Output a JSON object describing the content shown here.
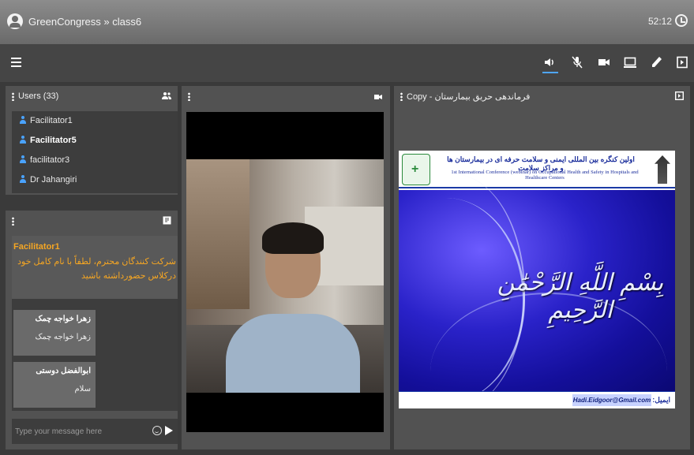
{
  "topbar": {
    "title": "GreenCongress » class6",
    "timer": "52:12"
  },
  "toolbar": {
    "speaker_icon": "speaker-icon",
    "mic_icon": "mic-off-icon",
    "camera_icon": "camera-icon",
    "screen_icon": "screen-share-icon",
    "pen_icon": "pen-icon",
    "exit_icon": "exit-icon"
  },
  "users_panel": {
    "title": "Users (33)",
    "users": [
      {
        "name": "Facilitator1",
        "bold": false
      },
      {
        "name": "Facilitator5",
        "bold": true
      },
      {
        "name": "facilitator3",
        "bold": false
      },
      {
        "name": "Dr Jahangiri",
        "bold": false
      }
    ]
  },
  "chat_panel": {
    "main_message": {
      "author": "Facilitator1",
      "text": "شرکت کنندگان محترم، لطفاً با نام کامل خود درکلاس حضورداشته باشید"
    },
    "messages": [
      {
        "name": "زهرا خواجه چمک",
        "text": "زهرا خواجه چمک"
      },
      {
        "name": "ابوالفضل دوستی",
        "text": "سلام"
      }
    ],
    "input_placeholder": "Type your message here"
  },
  "document_panel": {
    "title": "فرماندهی حریق بیمارستان - Copy",
    "slide": {
      "title_fa": "اولین کنگره بین المللی ایمنی و سلامت حرفه ای در بیمارستان ها و مراکز سلامت",
      "title_en": "1st International Conference (webinar) on Occupational Health and Safety in Hospitals and Healthcare Centers",
      "calligraphy": "بِسْمِ اللَّهِ الرَّحْمَٰنِ الرَّحِيمِ",
      "footer_label": "ایمیل:",
      "footer_email": "Hadi.Eidgoor@Gmail.com"
    }
  }
}
